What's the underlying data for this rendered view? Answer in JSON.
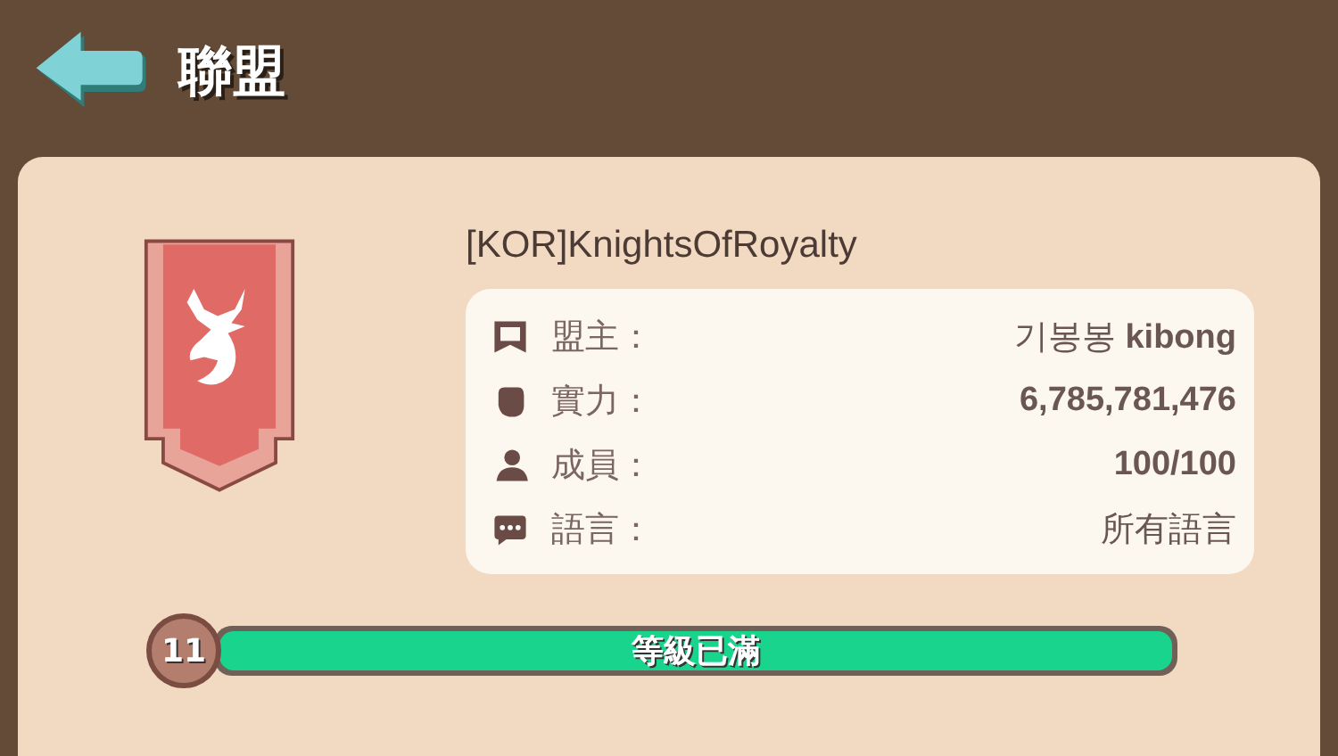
{
  "header": {
    "title": "聯盟"
  },
  "alliance": {
    "name": "[KOR]KnightsOfRoyalty",
    "info": [
      {
        "kind": "leader",
        "label": "盟主：",
        "value": "기봉봉 **kibong**"
      },
      {
        "kind": "power",
        "label": "實力：",
        "value": "**6,785,781,476**"
      },
      {
        "kind": "members",
        "label": "成員：",
        "value": "**100/100**"
      },
      {
        "kind": "language",
        "label": "語言：",
        "value": "所有語言"
      }
    ],
    "level_badge": "11",
    "progress": {
      "level": 1.0,
      "label": "等級已滿"
    }
  }
}
